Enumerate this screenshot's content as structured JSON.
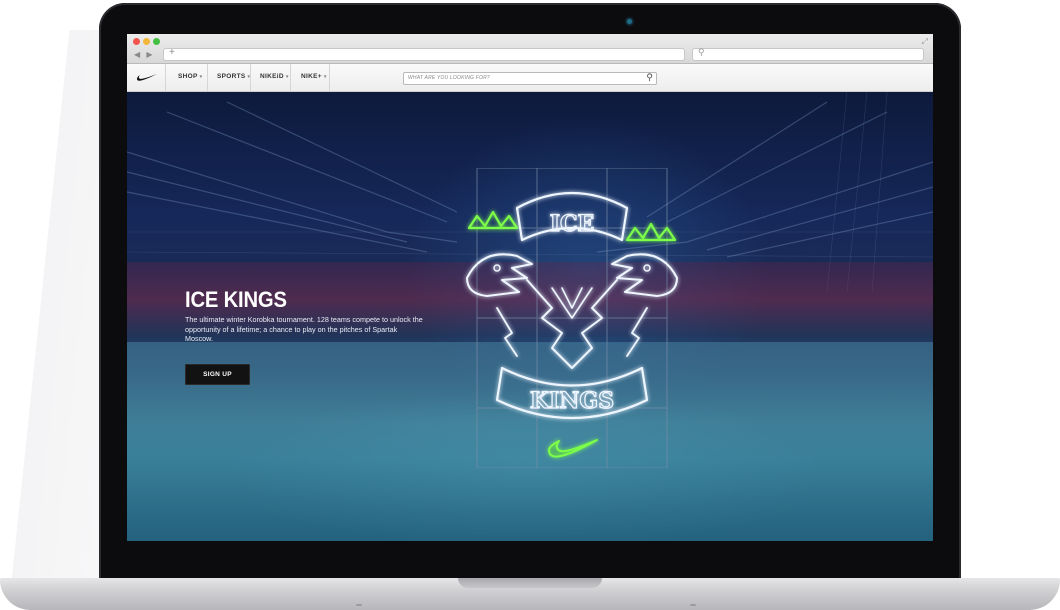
{
  "browser": {
    "new_tab_symbol": "+",
    "nav_arrows": "◀ ▶",
    "search_symbol": "⚲",
    "expand_symbol": "⤢"
  },
  "site_nav": {
    "items": [
      {
        "label": "SHOP"
      },
      {
        "label": "SPORTS"
      },
      {
        "label": "NIKEiD"
      },
      {
        "label": "NIKE+"
      }
    ],
    "search_placeholder": "WHAT ARE YOU LOOKING FOR?"
  },
  "hero": {
    "title": "ICE KINGS",
    "description": "The ultimate winter Korobka tournament. 128 teams compete to unlock the opportunity of a lifetime; a chance to play on the pitches of Spartak Moscow.",
    "button_label": "SIGN UP",
    "emblem_top_text": "ICE",
    "emblem_bottom_text": "KINGS"
  },
  "colors": {
    "neon_white": "#eef6ff",
    "neon_green": "#7dff4a",
    "button_bg": "#121212"
  },
  "icons": [
    "nike-swoosh-icon",
    "search-icon",
    "chevron-down-icon",
    "crown-icon",
    "eagle-icon"
  ]
}
